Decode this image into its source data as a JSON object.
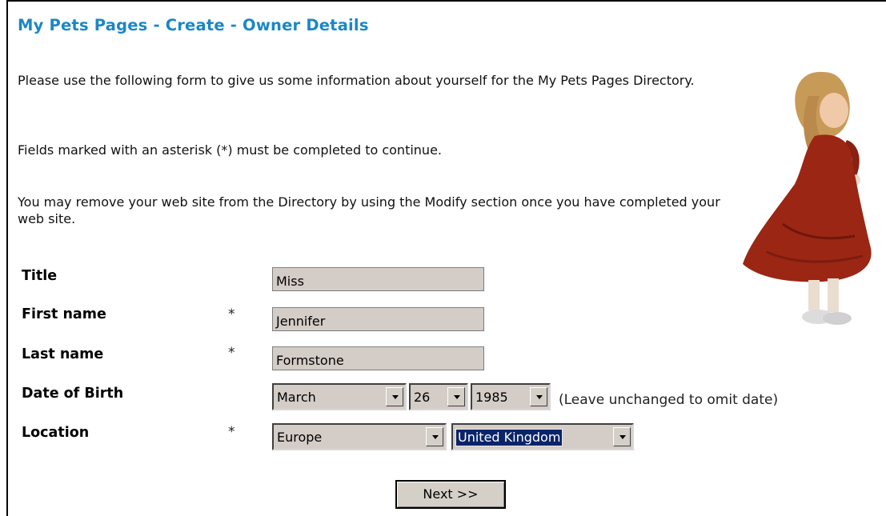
{
  "header": {
    "title": "My Pets Pages - Create - Owner Details"
  },
  "intro": {
    "paragraph1": "Please use the following form to give us some information about yourself for the My Pets Pages Directory.",
    "paragraph2": "Fields marked with an asterisk (*) must be completed to continue.",
    "paragraph3": "You may remove your web site from the Directory by using the Modify section once you have completed your web site."
  },
  "form": {
    "title": {
      "label": "Title",
      "value": "Miss",
      "required": ""
    },
    "first_name": {
      "label": "First name",
      "value": "Jennifer",
      "required": "*"
    },
    "last_name": {
      "label": "Last name",
      "value": "Formstone",
      "required": "*"
    },
    "date_of_birth": {
      "label": "Date of Birth",
      "month": "March",
      "day": "26",
      "year": "1985",
      "hint": "(Leave unchanged to omit date)"
    },
    "location": {
      "label": "Location",
      "required": "*",
      "region": "Europe",
      "country": "United Kingdom"
    },
    "next_button": "Next >>"
  },
  "colors": {
    "title": "#1a87c6",
    "field_bg": "#d4ccc7",
    "selection_bg": "#0a246a"
  }
}
